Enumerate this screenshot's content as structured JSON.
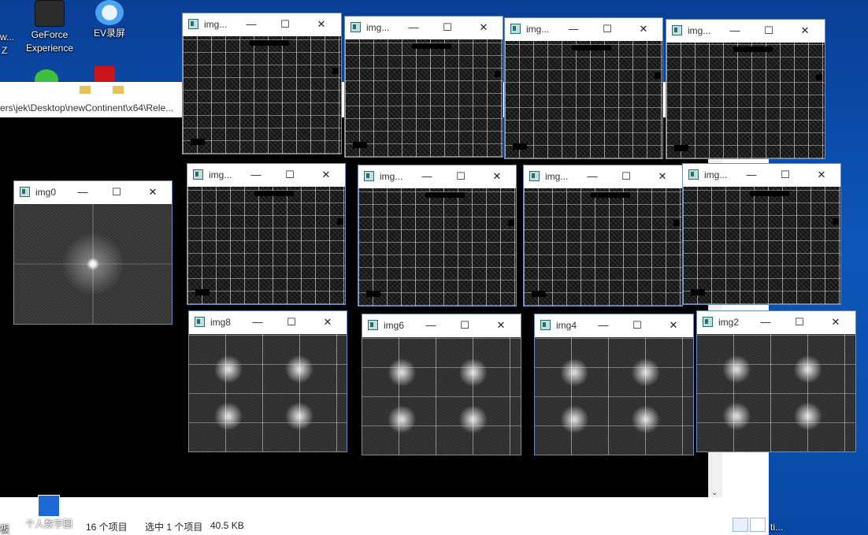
{
  "desktop": {
    "icons": [
      {
        "label_line1": "GeForce",
        "label_line2": "Experience",
        "icon": "nvidia-icon"
      },
      {
        "label_line1": "EV录屏",
        "label_line2": "",
        "icon": "ev-recorder-icon"
      },
      {
        "label_line1": "个人数字图",
        "label_line2": "",
        "icon": "folder-shortcut-icon"
      }
    ],
    "left_fragment_1": "w...",
    "left_fragment_2": "Z",
    "left_fragment_3": "板",
    "right_fragment": "ti..."
  },
  "explorer": {
    "address_path": "ers\\jek\\Desktop\\newContinent\\x64\\Rele...",
    "status_items": "16 个项目",
    "status_selected": "选中 1 个项目",
    "status_size": "40.5 KB"
  },
  "windows": [
    {
      "title": "img...",
      "style": "grid"
    },
    {
      "title": "img...",
      "style": "grid"
    },
    {
      "title": "img...",
      "style": "grid"
    },
    {
      "title": "img...",
      "style": "grid"
    },
    {
      "title": "img0",
      "style": "spec"
    },
    {
      "title": "img...",
      "style": "grid"
    },
    {
      "title": "img...",
      "style": "grid"
    },
    {
      "title": "img...",
      "style": "grid"
    },
    {
      "title": "img...",
      "style": "grid"
    },
    {
      "title": "img8",
      "style": "cross"
    },
    {
      "title": "img6",
      "style": "cross"
    },
    {
      "title": "img4",
      "style": "cross"
    },
    {
      "title": "img2",
      "style": "cross"
    }
  ],
  "controls": {
    "minimize": "—",
    "maximize": "☐",
    "close": "✕"
  }
}
